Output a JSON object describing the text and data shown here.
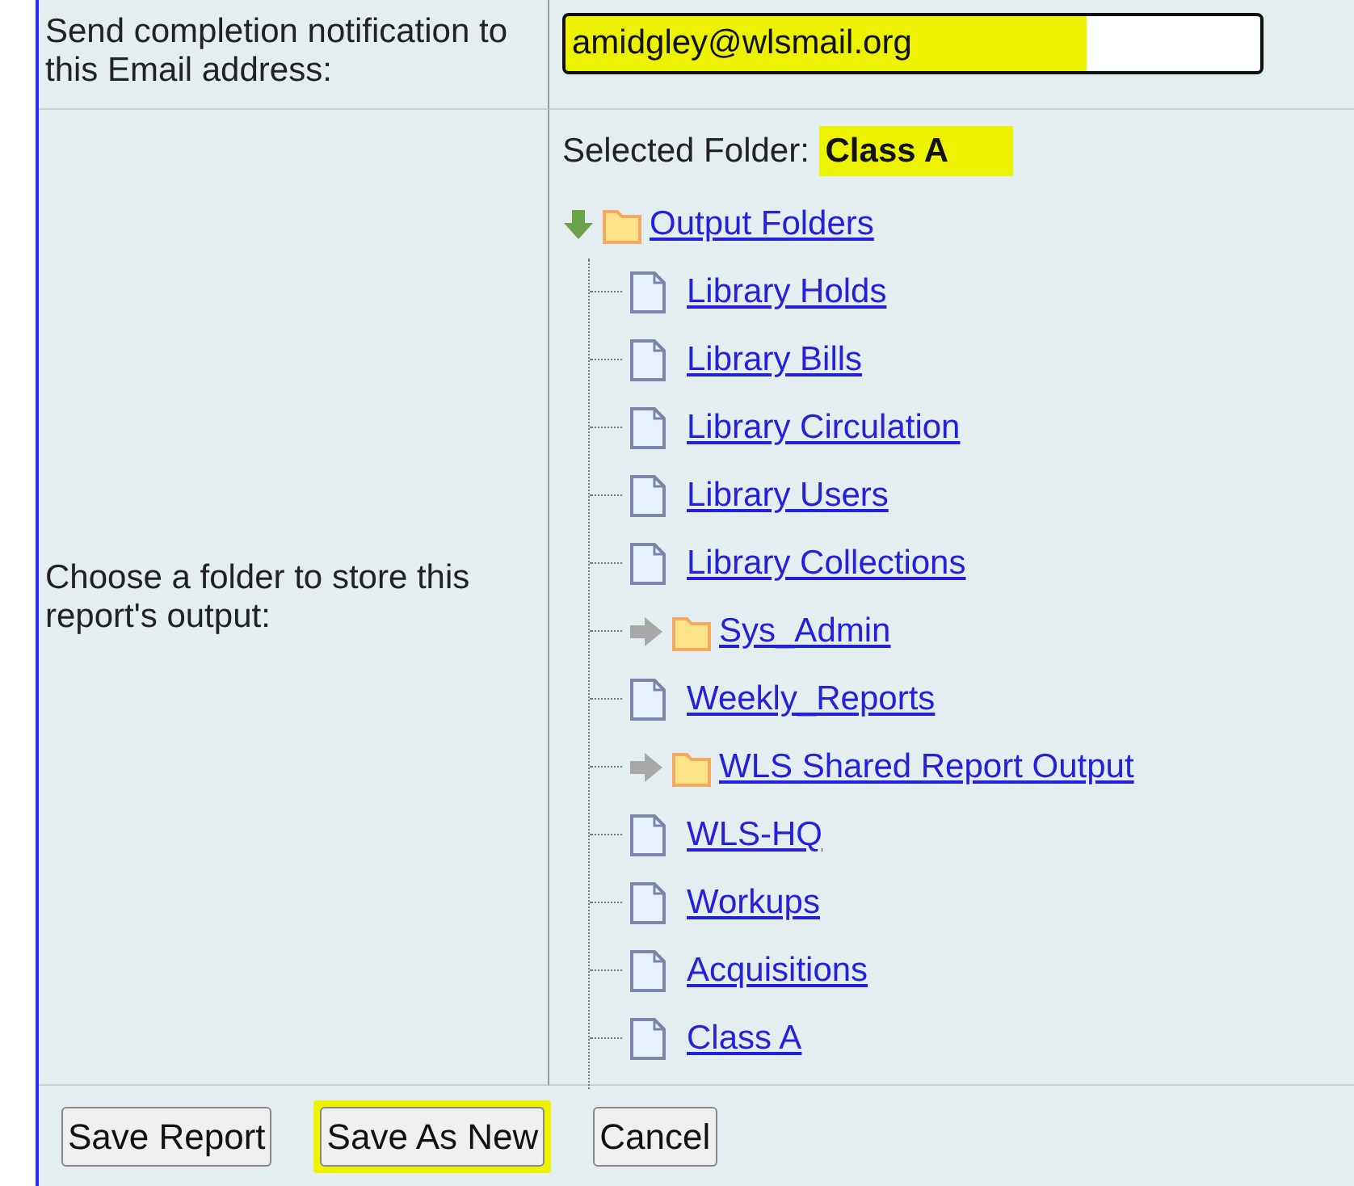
{
  "email_row": {
    "label": "Send completion notification to this Email address:",
    "value": "amidgley@wlsmail.org",
    "highlighted": true
  },
  "folder_row": {
    "label": "Choose a folder to store this report's output:",
    "selected_label": "Selected Folder:",
    "selected_value": "Class A",
    "selected_highlighted": true,
    "tree": {
      "label": "Output Folders",
      "kind": "folder",
      "expanded": true,
      "children": [
        {
          "label": "Library Holds",
          "kind": "file"
        },
        {
          "label": "Library Bills",
          "kind": "file"
        },
        {
          "label": "Library Circulation",
          "kind": "file"
        },
        {
          "label": "Library Users",
          "kind": "file"
        },
        {
          "label": "Library Collections",
          "kind": "file"
        },
        {
          "label": "Sys_Admin",
          "kind": "folder",
          "expanded": false
        },
        {
          "label": "Weekly_Reports",
          "kind": "file"
        },
        {
          "label": "WLS Shared Report Output",
          "kind": "folder",
          "expanded": false
        },
        {
          "label": "WLS-HQ",
          "kind": "file"
        },
        {
          "label": "Workups",
          "kind": "file"
        },
        {
          "label": "Acquisitions",
          "kind": "file"
        },
        {
          "label": "Class A",
          "kind": "file"
        }
      ]
    }
  },
  "buttons": [
    {
      "label": "Save Report",
      "highlighted": false
    },
    {
      "label": "Save As New",
      "highlighted": true
    },
    {
      "label": "Cancel",
      "highlighted": false
    }
  ]
}
